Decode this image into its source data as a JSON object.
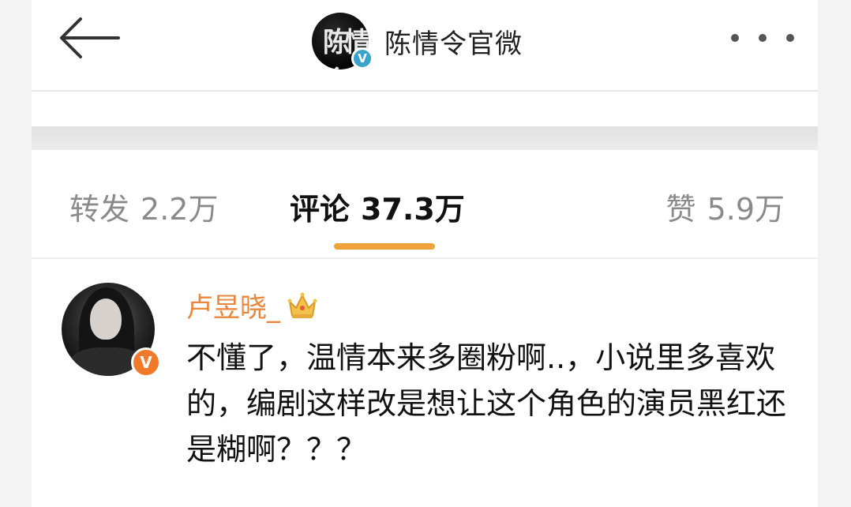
{
  "header": {
    "title": "陈情令官微",
    "brand_glyph": "陈情令",
    "verified_mark": "V"
  },
  "tabs": [
    {
      "label": "转发",
      "count": "2.2万"
    },
    {
      "label": "评论",
      "count": "37.3万"
    },
    {
      "label": "赞",
      "count": "5.9万"
    }
  ],
  "colors": {
    "accent": "#f0a23a",
    "username": "#e8863d",
    "verified": "#3aa3c9",
    "vip": "#f07a2a"
  },
  "comment": {
    "username": "卢昱晓_",
    "vip_mark": "V",
    "text": "不懂了，温情本来多圈粉啊..，小说里多喜欢的，编剧这样改是想让这个角色的演员黑红还是糊啊？？？"
  },
  "icons": [
    "back-arrow-icon",
    "more-icon",
    "verified-icon",
    "crown-icon",
    "vip-icon"
  ]
}
